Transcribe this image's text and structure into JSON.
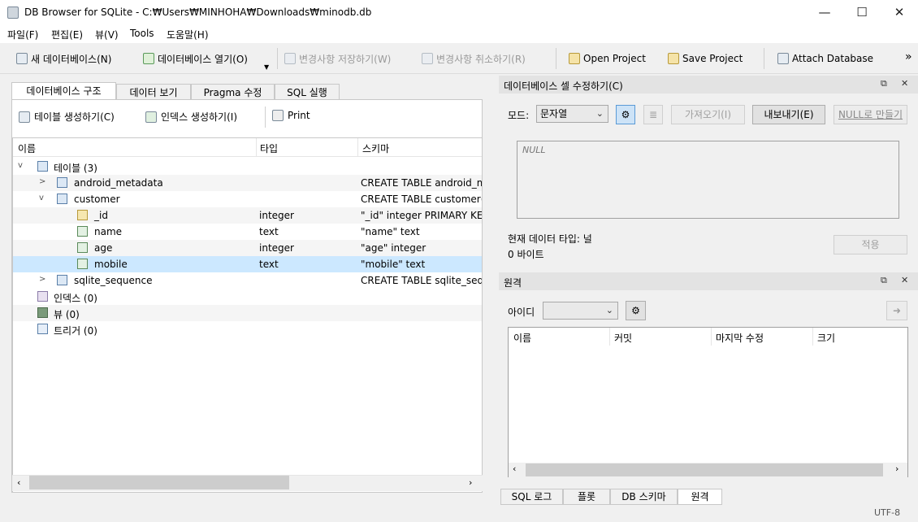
{
  "window": {
    "title": "DB Browser for SQLite - C:₩Users₩MINHOHA₩Downloads₩minodb.db",
    "minimize": "—",
    "maximize": "☐",
    "close": "✕"
  },
  "menu": [
    "파일(F)",
    "편집(E)",
    "뷰(V)",
    "Tools",
    "도움말(H)"
  ],
  "toolbar": {
    "new_db": "새 데이터베이스(N)",
    "open_db": "데이터베이스 열기(O)",
    "write": "변경사항 저장하기(W)",
    "revert": "변경사항 취소하기(R)",
    "open_project": "Open Project",
    "save_project": "Save Project",
    "attach": "Attach Database",
    "more": "»"
  },
  "main_tabs": [
    "데이터베이스 구조",
    "데이터 보기",
    "Pragma 수정",
    "SQL 실행"
  ],
  "structure_toolbar": {
    "create_table": "테이블 생성하기(C)",
    "create_index": "인덱스 생성하기(I)",
    "print": "Print"
  },
  "tree": {
    "headers": [
      "이름",
      "타입",
      "스키마"
    ],
    "rows": [
      {
        "arrow": "v",
        "name": "테이블 (3)",
        "type": "",
        "schema": ""
      },
      {
        "arrow": ">",
        "name": "android_metadata",
        "type": "",
        "schema": "CREATE TABLE android_metadata"
      },
      {
        "arrow": "v",
        "name": "customer",
        "type": "",
        "schema": "CREATE TABLE customer(_id"
      },
      {
        "arrow": "",
        "name": "_id",
        "type": "integer",
        "schema": "\"_id\" integer PRIMARY KEY AUTOINCREMENT"
      },
      {
        "arrow": "",
        "name": "name",
        "type": "text",
        "schema": "\"name\" text"
      },
      {
        "arrow": "",
        "name": "age",
        "type": "integer",
        "schema": "\"age\" integer"
      },
      {
        "arrow": "",
        "name": "mobile",
        "type": "text",
        "schema": "\"mobile\" text"
      },
      {
        "arrow": ">",
        "name": "sqlite_sequence",
        "type": "",
        "schema": "CREATE TABLE sqlite_sequence"
      },
      {
        "arrow": "",
        "name": "인덱스 (0)",
        "type": "",
        "schema": ""
      },
      {
        "arrow": "",
        "name": "뷰 (0)",
        "type": "",
        "schema": ""
      },
      {
        "arrow": "",
        "name": "트리거 (0)",
        "type": "",
        "schema": ""
      }
    ]
  },
  "edit_cell": {
    "title": "데이터베이스 셀 수정하기(C)",
    "mode_label": "모드:",
    "mode_value": "문자열",
    "import": "가져오기(I)",
    "export": "내보내기(E)",
    "set_null": "NULL로 만들기",
    "value": "NULL",
    "type_label": "현재 데이터 타입: 널",
    "size_label": "0 바이트",
    "apply": "적용"
  },
  "remote": {
    "title": "원격",
    "identity_label": "아이디",
    "columns": [
      "이름",
      "커밋",
      "마지막 수정",
      "크기"
    ]
  },
  "bottom_tabs": [
    "SQL 로그",
    "플롯",
    "DB 스키마",
    "원격"
  ],
  "status": {
    "encoding": "UTF-8"
  },
  "colors": {
    "selection": "#cce8ff",
    "panel": "#f0f0f0"
  }
}
